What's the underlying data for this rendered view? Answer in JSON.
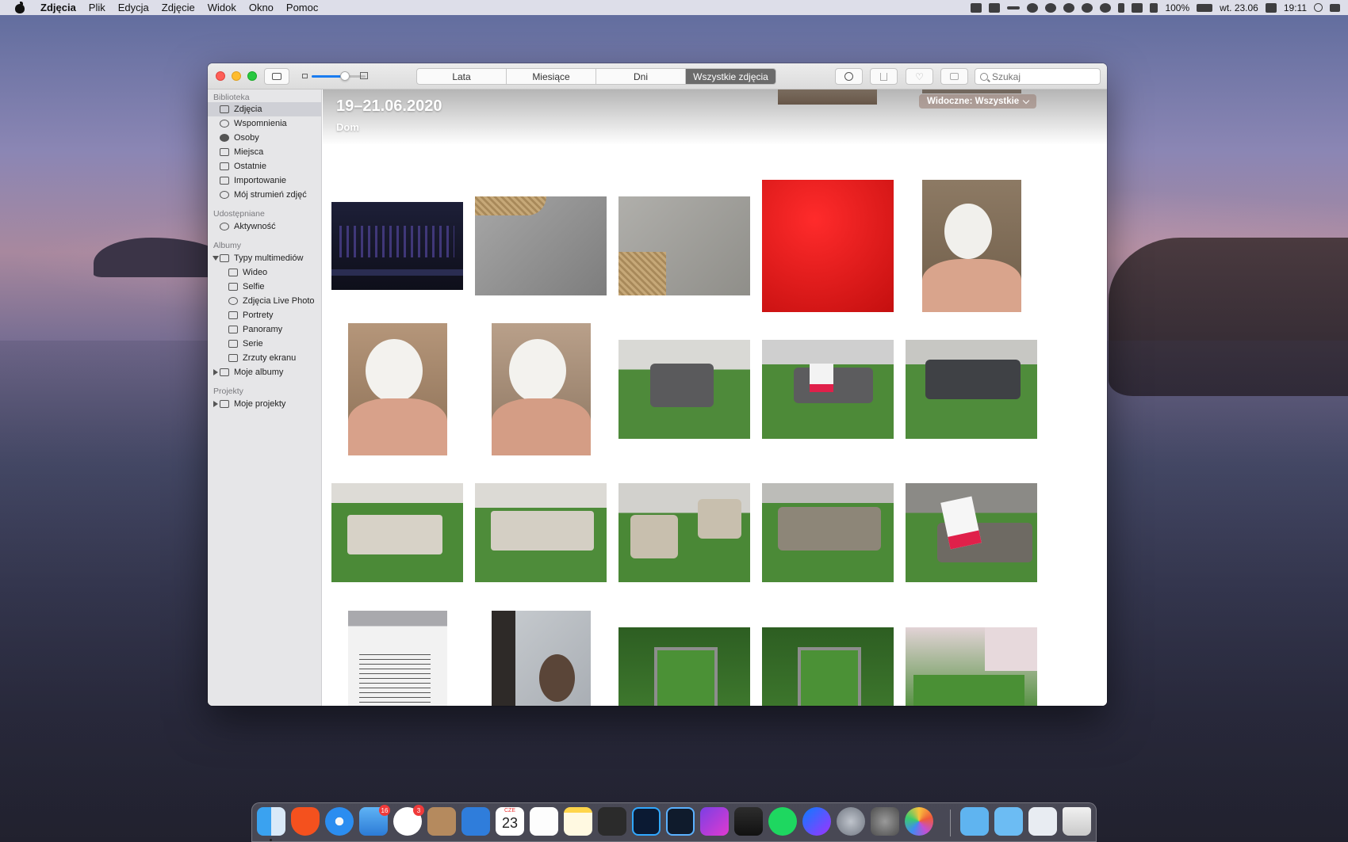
{
  "menubar": {
    "app": "Zdjęcia",
    "items": [
      "Plik",
      "Edycja",
      "Zdjęcie",
      "Widok",
      "Okno",
      "Pomoc"
    ],
    "battery": "100%",
    "date": "wt. 23.06",
    "time": "19:11"
  },
  "toolbar": {
    "segments": [
      "Lata",
      "Miesiące",
      "Dni",
      "Wszystkie zdjęcia"
    ],
    "active_segment": "Wszystkie zdjęcia",
    "search_placeholder": "Szukaj",
    "zoom_level": 0.62
  },
  "sidebar": {
    "sections": [
      {
        "title": "Biblioteka"
      },
      {
        "title": "Udostępniane"
      },
      {
        "title": "Albumy"
      },
      {
        "title": "Projekty"
      }
    ],
    "library": [
      "Zdjęcia",
      "Wspomnienia",
      "Osoby",
      "Miejsca",
      "Ostatnie",
      "Importowanie",
      "Mój strumień zdjęć"
    ],
    "shared": [
      "Aktywność"
    ],
    "albums_group": "Typy multimediów",
    "media_types": [
      "Wideo",
      "Selfie",
      "Zdjęcia Live Photo",
      "Portrety",
      "Panoramy",
      "Serie",
      "Zrzuty ekranu"
    ],
    "my_albums": "Moje albumy",
    "projects": "Moje projekty"
  },
  "content": {
    "date_range": "19–21.06.2020",
    "place": "Dom",
    "visible_label": "Widoczne: Wszystkie",
    "accent": "#1a7cf0"
  },
  "dock": {
    "badges": {
      "mail": "16",
      "slack": "3"
    },
    "calendar_month": "CZE",
    "calendar_day": "23"
  }
}
